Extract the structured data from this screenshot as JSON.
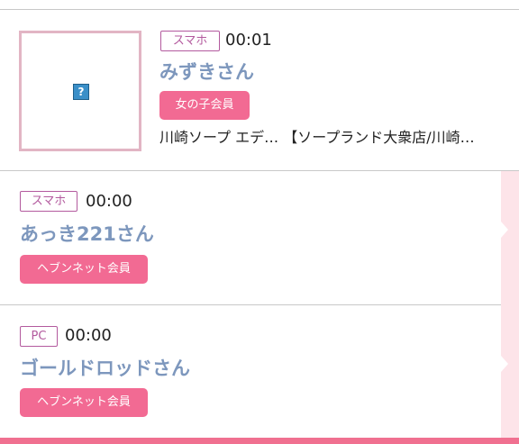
{
  "entries": [
    {
      "device": "スマホ",
      "time": "00:01",
      "name": "みずきさん",
      "member_type": "女の子会員",
      "shop": "川崎ソープ エデ… 【ソープランド大衆店/川崎…",
      "thumbnail_icon": "broken-image-icon"
    },
    {
      "device": "スマホ",
      "time": "00:00",
      "name": "あっき221さん",
      "member_type": "ヘブンネット会員"
    },
    {
      "device": "PC",
      "time": "00:00",
      "name": "ゴールドロッドさん",
      "member_type": "ヘブンネット会員"
    }
  ],
  "colors": {
    "device_border": "#b35a9e",
    "name": "#7d97bd",
    "badge": "#f26a93",
    "side_strip": "#fde4e9",
    "bottom_bar": "#f07090"
  }
}
